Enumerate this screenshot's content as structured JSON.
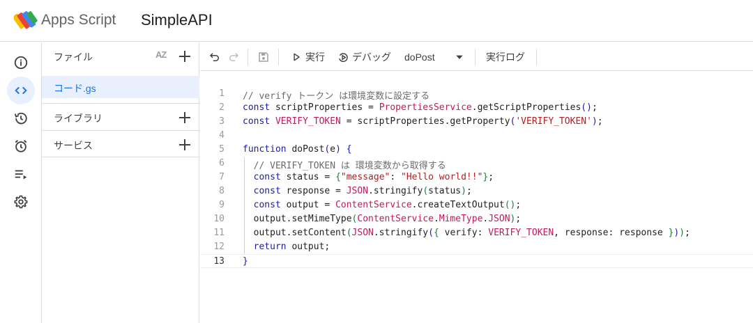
{
  "header": {
    "app_name": "Apps Script",
    "project_name": "SimpleAPI"
  },
  "rail": {
    "items": [
      {
        "icon": "info-icon",
        "active": false
      },
      {
        "icon": "code-icon",
        "active": true
      },
      {
        "icon": "history-icon",
        "active": false
      },
      {
        "icon": "alarm-icon",
        "active": false
      },
      {
        "icon": "executions-icon",
        "active": false
      },
      {
        "icon": "gear-icon",
        "active": false
      }
    ]
  },
  "files_panel": {
    "title": "ファイル",
    "sort_label": "AZ",
    "files": [
      {
        "name": "コード.gs",
        "selected": true
      }
    ],
    "libraries_label": "ライブラリ",
    "services_label": "サービス"
  },
  "toolbar": {
    "run_label": "実行",
    "debug_label": "デバッグ",
    "function_select": "doPost",
    "log_label": "実行ログ"
  },
  "editor": {
    "current_line": 13,
    "lines": [
      {
        "n": "1",
        "tokens": [
          [
            "cm",
            "// verify トークン は環境変数に設定する"
          ]
        ]
      },
      {
        "n": "2",
        "tokens": [
          [
            "kw",
            "const"
          ],
          [
            "",
            " scriptProperties = "
          ],
          [
            "cls",
            "PropertiesService"
          ],
          [
            "",
            ".getScriptProperties"
          ],
          [
            "b1",
            "()"
          ],
          [
            "",
            ";"
          ]
        ]
      },
      {
        "n": "3",
        "tokens": [
          [
            "kw",
            "const"
          ],
          [
            "",
            " "
          ],
          [
            "cls",
            "VERIFY_TOKEN"
          ],
          [
            "",
            " = scriptProperties.getProperty"
          ],
          [
            "b1",
            "("
          ],
          [
            "str",
            "'VERIFY_TOKEN'"
          ],
          [
            "b1",
            ")"
          ],
          [
            "",
            ";"
          ]
        ]
      },
      {
        "n": "4",
        "tokens": []
      },
      {
        "n": "5",
        "tokens": [
          [
            "kw",
            "function"
          ],
          [
            "",
            " doPost"
          ],
          [
            "b1",
            "("
          ],
          [
            "",
            "e"
          ],
          [
            "b1",
            ")"
          ],
          [
            "",
            " "
          ],
          [
            "b1",
            "{"
          ]
        ]
      },
      {
        "n": "6",
        "tokens": [
          [
            "cm",
            "  // VERIFY_TOKEN は 環境変数から取得する"
          ]
        ]
      },
      {
        "n": "7",
        "tokens": [
          [
            "",
            "  "
          ],
          [
            "kw",
            "const"
          ],
          [
            "",
            " status = "
          ],
          [
            "b2",
            "{"
          ],
          [
            "str",
            "\"message\""
          ],
          [
            "",
            ": "
          ],
          [
            "str",
            "\"Hello world!!\""
          ],
          [
            "b2",
            "}"
          ],
          [
            "",
            ";"
          ]
        ]
      },
      {
        "n": "8",
        "tokens": [
          [
            "",
            "  "
          ],
          [
            "kw",
            "const"
          ],
          [
            "",
            " response = "
          ],
          [
            "cls",
            "JSON"
          ],
          [
            "",
            ".stringify"
          ],
          [
            "b2",
            "("
          ],
          [
            "",
            "status"
          ],
          [
            "b2",
            ")"
          ],
          [
            "",
            ";"
          ]
        ]
      },
      {
        "n": "9",
        "tokens": [
          [
            "",
            "  "
          ],
          [
            "kw",
            "const"
          ],
          [
            "",
            " output = "
          ],
          [
            "cls",
            "ContentService"
          ],
          [
            "",
            ".createTextOutput"
          ],
          [
            "b2",
            "()"
          ],
          [
            "",
            ";"
          ]
        ]
      },
      {
        "n": "10",
        "tokens": [
          [
            "",
            "  output.setMimeType"
          ],
          [
            "b2",
            "("
          ],
          [
            "cls",
            "ContentService"
          ],
          [
            "",
            "."
          ],
          [
            "cls",
            "MimeType"
          ],
          [
            "",
            "."
          ],
          [
            "cls",
            "JSON"
          ],
          [
            "b2",
            ")"
          ],
          [
            "",
            ";"
          ]
        ]
      },
      {
        "n": "11",
        "tokens": [
          [
            "",
            "  output.setContent"
          ],
          [
            "b2",
            "("
          ],
          [
            "cls",
            "JSON"
          ],
          [
            "",
            ".stringify"
          ],
          [
            "b1",
            "("
          ],
          [
            "b2",
            "{"
          ],
          [
            "",
            " verify: "
          ],
          [
            "cls",
            "VERIFY_TOKEN"
          ],
          [
            "",
            ", response: response "
          ],
          [
            "b2",
            "}"
          ],
          [
            "b1",
            ")"
          ],
          [
            "b2",
            ")"
          ],
          [
            "",
            ";"
          ]
        ]
      },
      {
        "n": "12",
        "tokens": [
          [
            "",
            "  "
          ],
          [
            "kw",
            "return"
          ],
          [
            "",
            " output;"
          ]
        ]
      },
      {
        "n": "13",
        "tokens": [
          [
            "b1",
            "}"
          ]
        ]
      }
    ]
  },
  "colors": {
    "accent": "#1a73e8",
    "active_bg": "#e8f0fe",
    "keyword": "#1a1ab0",
    "class": "#c2185b",
    "string": "#b71c1c",
    "comment": "#6b6b6b"
  }
}
